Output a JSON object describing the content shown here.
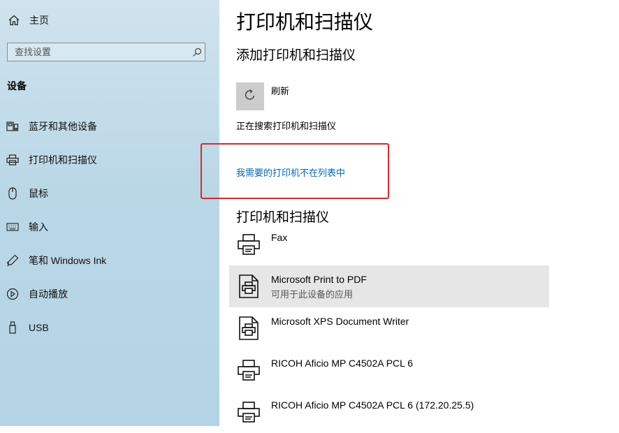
{
  "sidebar": {
    "home_label": "主页",
    "search_placeholder": "查找设置",
    "section_title": "设备",
    "items": [
      {
        "label": "蓝牙和其他设备",
        "icon": "bluetooth-devices-icon"
      },
      {
        "label": "打印机和扫描仪",
        "icon": "printer-icon"
      },
      {
        "label": "鼠标",
        "icon": "mouse-icon"
      },
      {
        "label": "输入",
        "icon": "keyboard-icon"
      },
      {
        "label": "笔和 Windows Ink",
        "icon": "pen-icon"
      },
      {
        "label": "自动播放",
        "icon": "autoplay-icon"
      },
      {
        "label": "USB",
        "icon": "usb-icon"
      }
    ]
  },
  "main": {
    "page_title": "打印机和扫描仪",
    "add_section_title": "添加打印机和扫描仪",
    "refresh_label": "刷新",
    "searching_text": "正在搜索打印机和扫描仪",
    "missing_printer_link": "我需要的打印机不在列表中",
    "list_title": "打印机和扫描仪",
    "printers": [
      {
        "name": "Fax",
        "status": "",
        "icon": "printer-icon",
        "selected": false
      },
      {
        "name": "Microsoft Print to PDF",
        "status": "可用于此设备的应用",
        "icon": "document-printer-icon",
        "selected": true
      },
      {
        "name": "Microsoft XPS Document Writer",
        "status": "",
        "icon": "document-printer-icon",
        "selected": false
      },
      {
        "name": "RICOH Aficio MP C4502A PCL 6",
        "status": "",
        "icon": "printer-icon",
        "selected": false
      },
      {
        "name": "RICOH Aficio MP C4502A PCL 6 (172.20.25.5)",
        "status": "",
        "icon": "printer-icon",
        "selected": false
      }
    ]
  },
  "colors": {
    "sidebar_bg": "#bad7e6",
    "link": "#0067b8",
    "highlight_box": "#e0262a",
    "selected_row": "#e6e6e6",
    "refresh_button": "#cccccc"
  }
}
